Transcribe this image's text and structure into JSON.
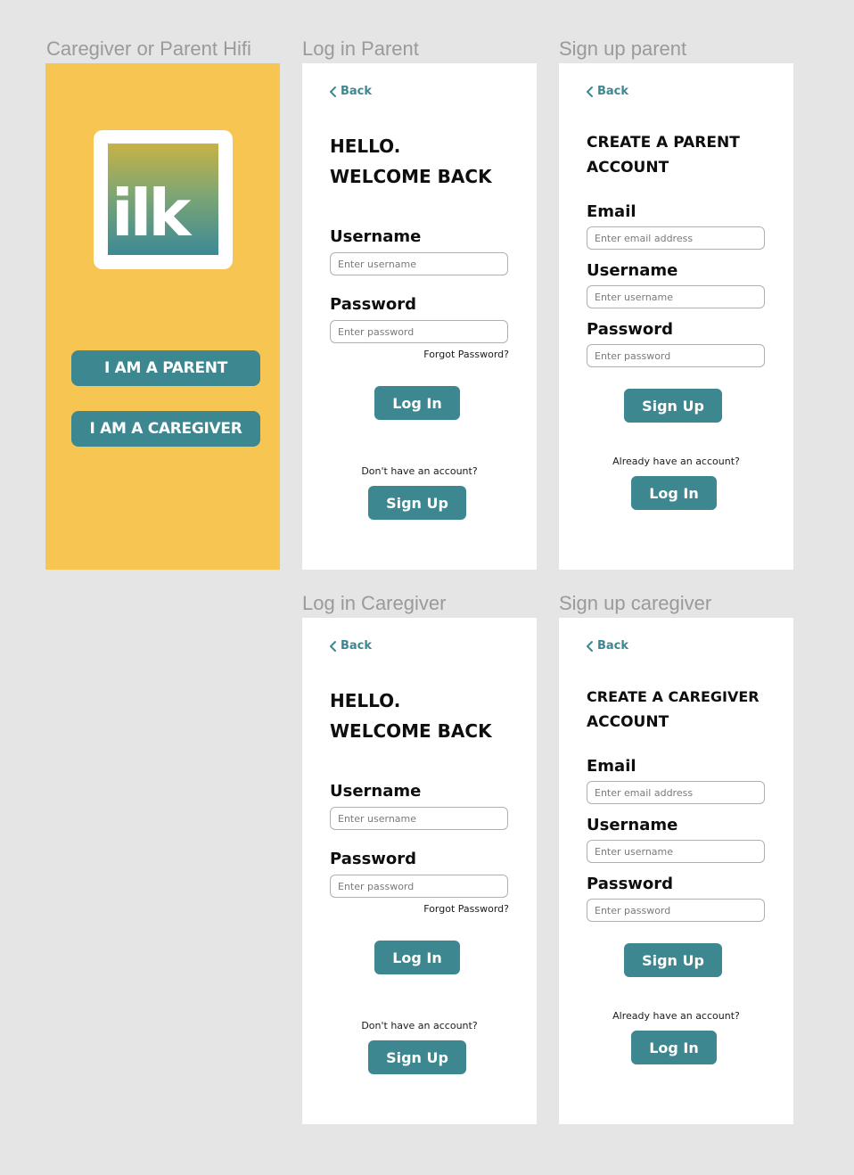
{
  "frames": {
    "welcome": {
      "label": "Caregiver or Parent Hifi",
      "logo_text": "ilk",
      "parent_button": "I AM A PARENT",
      "caregiver_button": "I AM A CAREGIVER"
    },
    "login_parent": {
      "label": "Log in Parent",
      "back": "Back",
      "title_line1": "HELLO.",
      "title_line2": "WELCOME BACK",
      "username_label": "Username",
      "username_placeholder": "Enter username",
      "password_label": "Password",
      "password_placeholder": "Enter password",
      "forgot": "Forgot Password?",
      "login_button": "Log In",
      "no_account": "Don't have an account?",
      "signup_button": "Sign Up"
    },
    "signup_parent": {
      "label": "Sign up parent",
      "back": "Back",
      "title_line1": "CREATE A PARENT",
      "title_line2": "ACCOUNT",
      "email_label": "Email",
      "email_placeholder": "Enter email address",
      "username_label": "Username",
      "username_placeholder": "Enter username",
      "password_label": "Password",
      "password_placeholder": "Enter password",
      "signup_button": "Sign Up",
      "have_account": "Already have an account?",
      "login_button": "Log In"
    },
    "login_caregiver": {
      "label": "Log in Caregiver",
      "back": "Back",
      "title_line1": "HELLO.",
      "title_line2": "WELCOME BACK",
      "username_label": "Username",
      "username_placeholder": "Enter username",
      "password_label": "Password",
      "password_placeholder": "Enter password",
      "forgot": "Forgot Password?",
      "login_button": "Log In",
      "no_account": "Don't have an account?",
      "signup_button": "Sign Up"
    },
    "signup_caregiver": {
      "label": "Sign up caregiver",
      "back": "Back",
      "title_line1": "CREATE A CAREGIVER",
      "title_line2": "ACCOUNT",
      "email_label": "Email",
      "email_placeholder": "Enter email address",
      "username_label": "Username",
      "username_placeholder": "Enter username",
      "password_label": "Password",
      "password_placeholder": "Enter password",
      "signup_button": "Sign Up",
      "have_account": "Already have an account?",
      "login_button": "Log In"
    }
  },
  "colors": {
    "background": "#e5e5e5",
    "yellow": "#f6c552",
    "teal": "#3d8790",
    "label_gray": "#9a9a9a"
  }
}
